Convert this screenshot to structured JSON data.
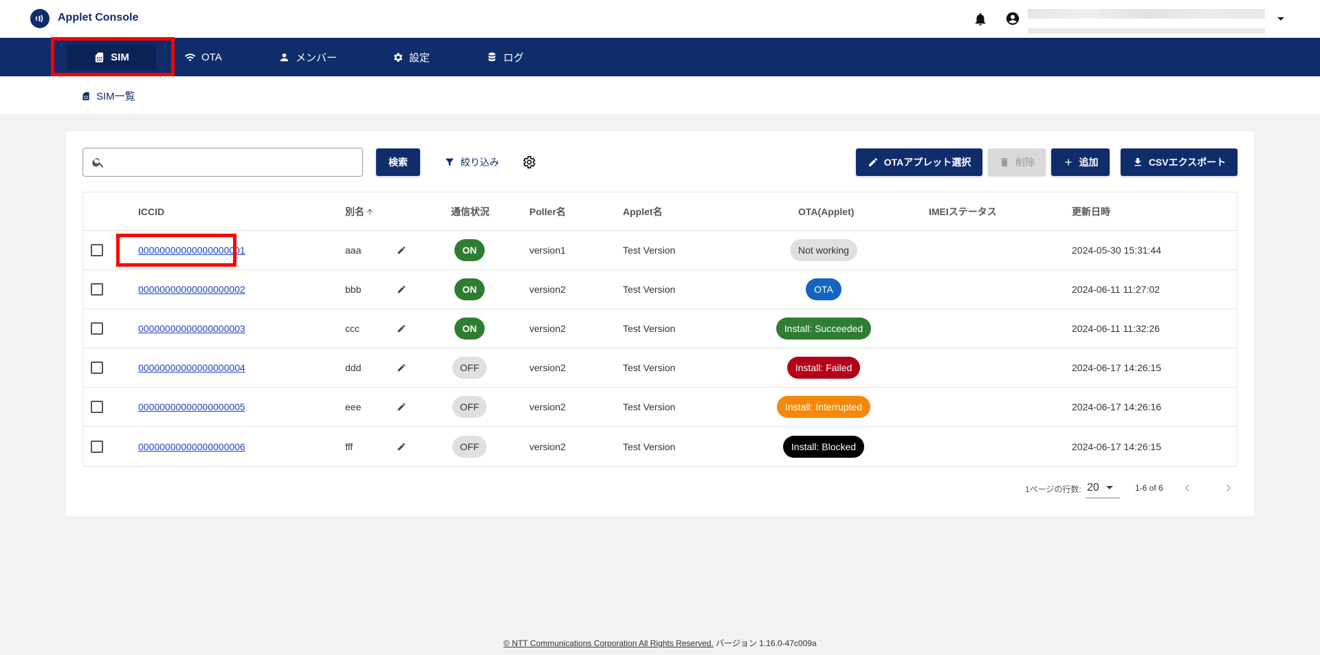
{
  "header": {
    "app_title": "Applet Console",
    "icons": [
      "bell-icon",
      "account-circle-icon",
      "chevron-down-icon"
    ]
  },
  "nav": {
    "items": [
      {
        "label": "SIM",
        "icon": "sim-card-icon",
        "active": true
      },
      {
        "label": "OTA",
        "icon": "wifi-icon",
        "active": false
      },
      {
        "label": "メンバー",
        "icon": "person-icon",
        "active": false
      },
      {
        "label": "設定",
        "icon": "gear-icon",
        "active": false
      },
      {
        "label": "ログ",
        "icon": "database-icon",
        "active": false
      }
    ]
  },
  "breadcrumb": {
    "label": "SIM一覧",
    "icon": "sim-card-icon"
  },
  "toolbar": {
    "search_placeholder": "",
    "search_button": "検索",
    "filter_label": "絞り込み",
    "ota_select_button": "OTAアプレット選択",
    "delete_button": "削除",
    "add_button": "追加",
    "csv_export_button": "CSVエクスポート"
  },
  "table": {
    "columns": [
      "ICCID",
      "別名",
      "通信状況",
      "Poller名",
      "Applet名",
      "OTA(Applet)",
      "IMEIステータス",
      "更新日時"
    ],
    "rows": [
      {
        "iccid": "00000000000000000001",
        "alias": "aaa",
        "status": "ON",
        "poller": "version1",
        "applet": "Test Version",
        "ota": "Not working",
        "ota_color": "#e0e0e0",
        "ota_text": "#333333",
        "imei": "",
        "updated": "2024-05-30 15:31:44"
      },
      {
        "iccid": "00000000000000000002",
        "alias": "bbb",
        "status": "ON",
        "poller": "version2",
        "applet": "Test Version",
        "ota": "OTA",
        "ota_color": "#1565c0",
        "ota_text": "#ffffff",
        "imei": "",
        "updated": "2024-06-11 11:27:02"
      },
      {
        "iccid": "00000000000000000003",
        "alias": "ccc",
        "status": "ON",
        "poller": "version2",
        "applet": "Test Version",
        "ota": "Install: Succeeded",
        "ota_color": "#2e7d32",
        "ota_text": "#ffffff",
        "imei": "",
        "updated": "2024-06-11 11:32:26"
      },
      {
        "iccid": "00000000000000000004",
        "alias": "ddd",
        "status": "OFF",
        "poller": "version2",
        "applet": "Test Version",
        "ota": "Install: Failed",
        "ota_color": "#b3001b",
        "ota_text": "#ffffff",
        "imei": "",
        "updated": "2024-06-17 14:26:15"
      },
      {
        "iccid": "00000000000000000005",
        "alias": "eee",
        "status": "OFF",
        "poller": "version2",
        "applet": "Test Version",
        "ota": "Install: Interrupted",
        "ota_color": "#f5880a",
        "ota_text": "#ffffff",
        "imei": "",
        "updated": "2024-06-17 14:26:16"
      },
      {
        "iccid": "00000000000000000006",
        "alias": "fff",
        "status": "OFF",
        "poller": "version2",
        "applet": "Test Version",
        "ota": "Install: Blocked",
        "ota_color": "#000000",
        "ota_text": "#ffffff",
        "imei": "",
        "updated": "2024-06-17 14:26:15"
      }
    ]
  },
  "pagination": {
    "rows_per_page_label": "1ページの行数:",
    "rows_per_page": "20",
    "range": "1-6 of 6"
  },
  "footer": {
    "copyright": "© NTT Communications Corporation All Rights Reserved.",
    "version": "バージョン 1.16.0-47c009a"
  },
  "colors": {
    "brand": "#0f2d6b",
    "highlight": "#ff0000"
  }
}
